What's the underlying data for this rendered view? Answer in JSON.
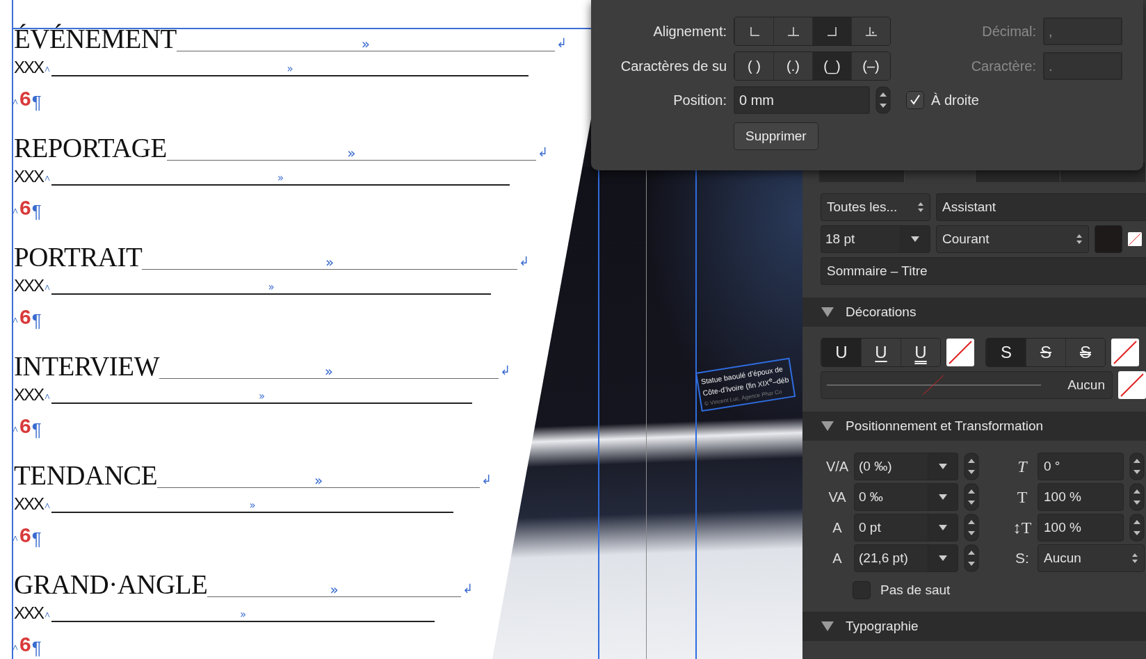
{
  "document": {
    "entries": [
      {
        "title": "ÉVÉNEMENT",
        "title_tab": "»",
        "title_break": "↲",
        "subtitle": "XXX",
        "subtitle_tab": "»",
        "page": "6",
        "pilcrow": "¶"
      },
      {
        "title": "REPORTAGE",
        "title_tab": "»",
        "title_break": "↲",
        "subtitle": "XXX",
        "subtitle_tab": "»",
        "page": "6",
        "pilcrow": "¶"
      },
      {
        "title": "PORTRAIT",
        "title_tab": "»",
        "title_break": "↲",
        "subtitle": "XXX",
        "subtitle_tab": "»",
        "page": "6",
        "pilcrow": "¶"
      },
      {
        "title": "INTERVIEW",
        "title_tab": "»",
        "title_break": "↲",
        "subtitle": "XXX",
        "subtitle_tab": "»",
        "page": "6",
        "pilcrow": "¶"
      },
      {
        "title": "TENDANCE",
        "title_tab": "»",
        "title_break": "↲",
        "subtitle": "XXX",
        "subtitle_tab": "»",
        "page": "6",
        "pilcrow": "¶"
      },
      {
        "title": "GRAND·ANGLE",
        "title_tab": "»",
        "title_break": "↲",
        "subtitle": "XXX",
        "subtitle_tab": "»",
        "page": "6",
        "pilcrow": "¶"
      }
    ],
    "caption": [
      "Statue baoulé d’époux de",
      "Côte-d’Ivoire (fin XIX$^{e}$–déb",
      "© Vincent Luc, Agence Phar Co"
    ]
  },
  "tab_popover": {
    "alignment": {
      "label": "Alignement:",
      "options": [
        {
          "kind": "left",
          "selected": false
        },
        {
          "kind": "center",
          "selected": false
        },
        {
          "kind": "right",
          "selected": true
        },
        {
          "kind": "decimal",
          "selected": false
        }
      ]
    },
    "leader": {
      "label": "Caractères de su",
      "options": [
        {
          "label": "( )",
          "selected": false
        },
        {
          "label": "(.)",
          "selected": false
        },
        {
          "label": "(_)",
          "selected": true
        },
        {
          "label": "(–)",
          "selected": false
        }
      ]
    },
    "position": {
      "label": "Position:",
      "value": "0 mm"
    },
    "align_right": {
      "label": "À droite",
      "checked": true
    },
    "decimal": {
      "label": "Décimal:",
      "value": ",",
      "disabled": true
    },
    "character": {
      "label": "Caractère:",
      "value": ".",
      "disabled": true
    },
    "delete_button": "Supprimer"
  },
  "panel": {
    "tabs": [
      {
        "selected": false
      },
      {
        "selected": true
      },
      {
        "selected": false
      },
      {
        "selected": false
      }
    ],
    "font_collection": "Toutes les...",
    "font": "Assistant",
    "size": "18 pt",
    "style": "Courant",
    "paragraph_style": "Sommaire – Titre",
    "decorations": {
      "title": "Décorations",
      "expanded": true,
      "underline": [
        {
          "label": "U",
          "kind": "none",
          "selected": true
        },
        {
          "label": "U",
          "kind": "single",
          "selected": false
        },
        {
          "label": "U",
          "kind": "double",
          "selected": false
        }
      ],
      "strike": [
        {
          "label": "S",
          "kind": "none",
          "selected": true
        },
        {
          "label": "S",
          "kind": "single",
          "selected": false
        },
        {
          "label": "S",
          "kind": "double",
          "selected": false
        }
      ],
      "line_value": "Aucun"
    },
    "positioning": {
      "title": "Positionnement et Transformation",
      "expanded": true,
      "rows": [
        {
          "left": {
            "symbol": "V/A",
            "value": "(0 ‰)"
          },
          "right": {
            "kind": "italic",
            "symbol": "T",
            "value": "0 °"
          }
        },
        {
          "left": {
            "symbol": "VA",
            "value": "0 ‰"
          },
          "right": {
            "kind": "plain",
            "symbol": "T",
            "value": "100 %"
          }
        },
        {
          "left": {
            "symbol": "A",
            "value": "0 pt"
          },
          "right": {
            "kind": "plain",
            "symbol": "↕T",
            "value": "100 %"
          }
        },
        {
          "left": {
            "symbol": "A",
            "value": "(21,6 pt)"
          },
          "right": {
            "kind": "select",
            "symbol": "S:",
            "value": "Aucun"
          }
        }
      ],
      "no_break": {
        "label": "Pas de saut",
        "checked": false
      }
    },
    "typography": {
      "title": "Typographie",
      "expanded": true
    }
  }
}
